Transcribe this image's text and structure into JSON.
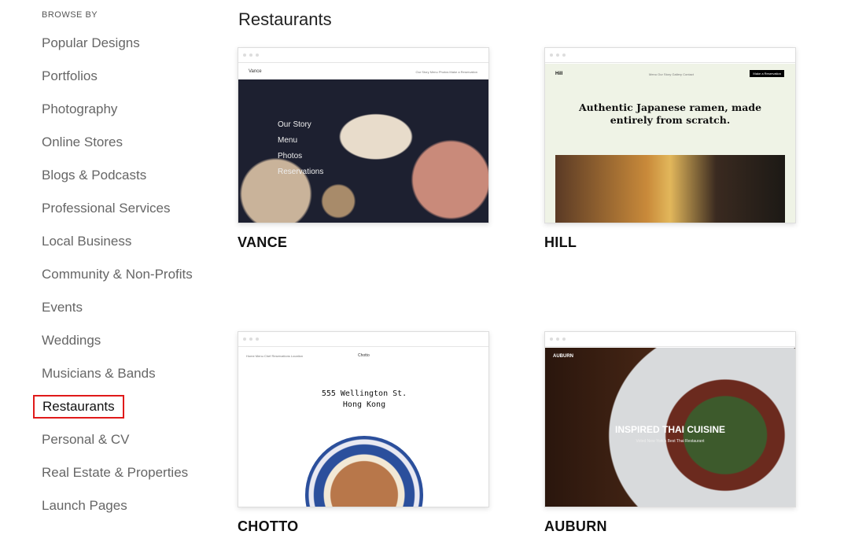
{
  "sidebar": {
    "heading": "BROWSE BY",
    "items": [
      "Popular Designs",
      "Portfolios",
      "Photography",
      "Online Stores",
      "Blogs & Podcasts",
      "Professional Services",
      "Local Business",
      "Community & Non-Profits",
      "Events",
      "Weddings",
      "Musicians & Bands",
      "Restaurants",
      "Personal & CV",
      "Real Estate & Properties",
      "Launch Pages"
    ],
    "active": "Restaurants",
    "highlight_color": "#e01a1a"
  },
  "main": {
    "title": "Restaurants",
    "templates": [
      {
        "name": "VANCE",
        "site_title": "Vance",
        "nav": "Our Story   Menu   Photos   Make a Reservation",
        "overlay": [
          "Our Story",
          "Menu",
          "Photos",
          "Reservations"
        ]
      },
      {
        "name": "HILL",
        "site_title": "Hill",
        "nav": "Menu   Our Story   Gallery   Contact",
        "button": "Make a Reservation",
        "headline": "Authentic Japanese ramen, made entirely from scratch."
      },
      {
        "name": "CHOTTO",
        "site_title": "Chotto",
        "nav": "Home  Menu  Chef  Reservations  Location",
        "headline": "555 Wellington St. Hong Kong"
      },
      {
        "name": "AUBURN",
        "site_title": "AUBURN",
        "headline": "INSPIRED THAI CUISINE",
        "subline": "Voted New York's Best Thai Restaurant"
      }
    ]
  }
}
